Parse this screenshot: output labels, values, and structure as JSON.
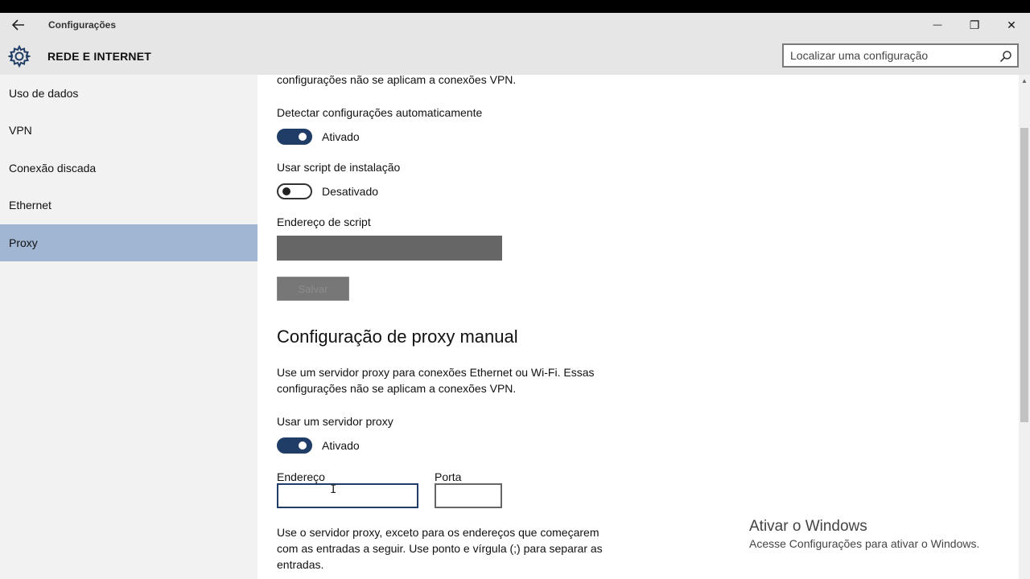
{
  "window": {
    "app_title": "Configurações",
    "back_icon": "back-arrow-icon",
    "controls": {
      "minimize": "—",
      "maximize": "❐",
      "close": "✕"
    }
  },
  "header": {
    "title": "REDE E INTERNET",
    "search": {
      "placeholder": "Localizar uma configuração",
      "value": ""
    }
  },
  "sidebar": {
    "items": [
      {
        "label": "Uso de dados",
        "selected": false
      },
      {
        "label": "VPN",
        "selected": false
      },
      {
        "label": "Conexão discada",
        "selected": false
      },
      {
        "label": "Ethernet",
        "selected": false
      },
      {
        "label": "Proxy",
        "selected": true
      }
    ]
  },
  "content": {
    "top_cut_text": "configurações não se aplicam a conexões VPN.",
    "auto_detect": {
      "label": "Detectar configurações automaticamente",
      "state": "Ativado",
      "on": true
    },
    "setup_script": {
      "label": "Usar script de instalação",
      "state": "Desativado",
      "on": false
    },
    "script_address": {
      "label": "Endereço de script",
      "value": ""
    },
    "save_button": "Salvar",
    "manual_heading": "Configuração de proxy manual",
    "manual_desc_line1": "Use um servidor proxy para conexões Ethernet ou Wi-Fi. Essas",
    "manual_desc_line2": "configurações não se aplicam a conexões VPN.",
    "use_proxy": {
      "label": "Usar um servidor proxy",
      "state": "Ativado",
      "on": true
    },
    "address": {
      "label": "Endereço",
      "value": ""
    },
    "port": {
      "label": "Porta",
      "value": ""
    },
    "exceptions_line1": "Use o servidor proxy, exceto para os endereços que começarem",
    "exceptions_line2": "com as entradas a seguir. Use ponto e vírgula (;) para separar as",
    "exceptions_line3": "entradas."
  },
  "watermark": {
    "title": "Ativar o Windows",
    "subtitle": "Acesse Configurações para ativar o Windows."
  },
  "colors": {
    "accent": "#1f3d66",
    "selected_item": "#a0b6d2",
    "chrome": "#e6e6e6",
    "sidebar": "#f2f2f2"
  }
}
